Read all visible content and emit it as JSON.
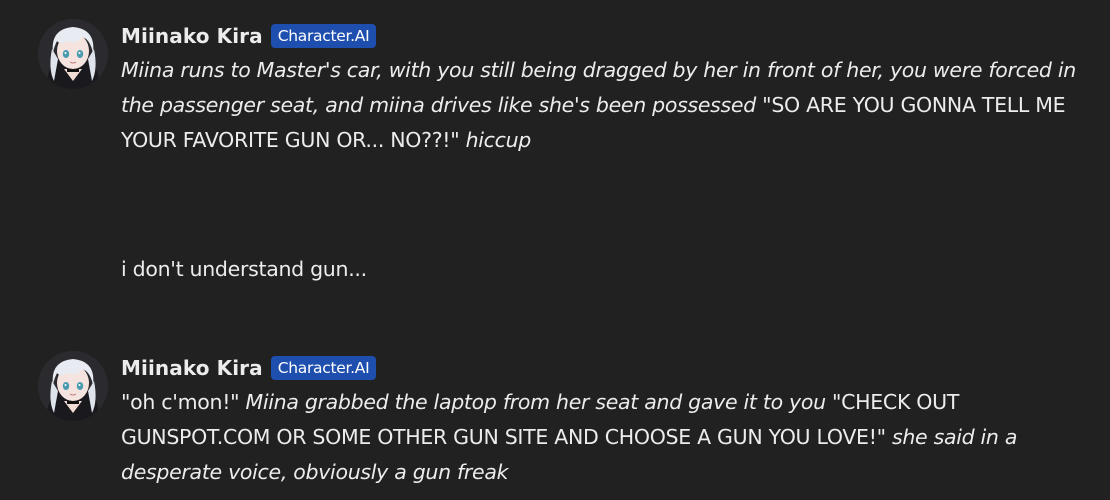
{
  "messages": [
    {
      "author": "Miinako Kira",
      "badge": "Character.AI",
      "parts": [
        "Miina runs to Master's car, with you still being dragged by her in front of her, you were forced in the passenger seat, and miina drives like she's been possessed",
        " \"SO ARE YOU GONNA TELL ME YOUR FAVORITE GUN OR... NO??!\" ",
        "hiccup"
      ]
    },
    {
      "author": "user",
      "text": "i don't understand gun..."
    },
    {
      "author": "Miinako Kira",
      "badge": "Character.AI",
      "parts": [
        "\"oh c'mon!\" ",
        "Miina grabbed the laptop from her seat and gave it to you",
        " \"CHECK OUT GUNSPOT.COM OR SOME OTHER GUN SITE AND CHOOSE A GUN YOU LOVE!\" ",
        "she said in a desperate voice, obviously a gun freak"
      ]
    }
  ],
  "icons": {
    "avatar": "anime-girl-avatar-icon"
  }
}
